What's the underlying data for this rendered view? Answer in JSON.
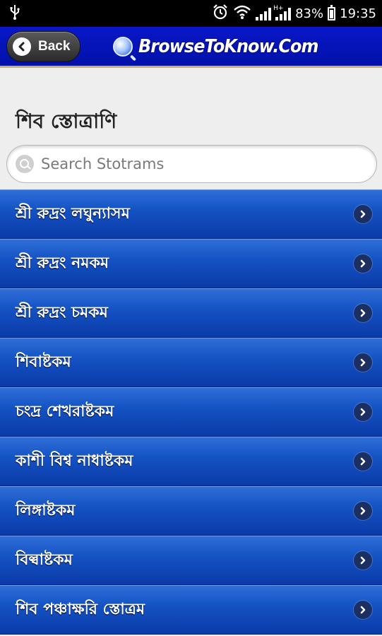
{
  "status_bar": {
    "usb_icon": "usb-icon",
    "battery_percent": "83%",
    "time": "19:35",
    "network_type": "H+"
  },
  "header": {
    "back_label": "Back",
    "brand": "BrowseToKnow.Com"
  },
  "page": {
    "title": "শিব স্তোত্রাণি"
  },
  "search": {
    "placeholder": "Search Stotrams",
    "value": ""
  },
  "list": {
    "items": [
      {
        "label": "শ্রী রুদ্রং লঘুন্যাসম"
      },
      {
        "label": "শ্রী রুদ্রং নমকম"
      },
      {
        "label": "শ্রী রুদ্রং চমকম"
      },
      {
        "label": "শিবাষ্টকম"
      },
      {
        "label": "চংদ্র শেখরাষ্টকম"
      },
      {
        "label": "কাশী বিশ্ব নাধাষ্টকম"
      },
      {
        "label": "লিঙ্গাষ্টকম"
      },
      {
        "label": "বিল্বাষ্টকম"
      },
      {
        "label": "শিব পঞ্চাক্ষরি স্তোত্রম"
      }
    ]
  },
  "colors": {
    "header_blue": "#0011a8",
    "header_accent": "#c9b26a",
    "list_blue": "#1553c4",
    "page_bg": "#eeeeee"
  }
}
